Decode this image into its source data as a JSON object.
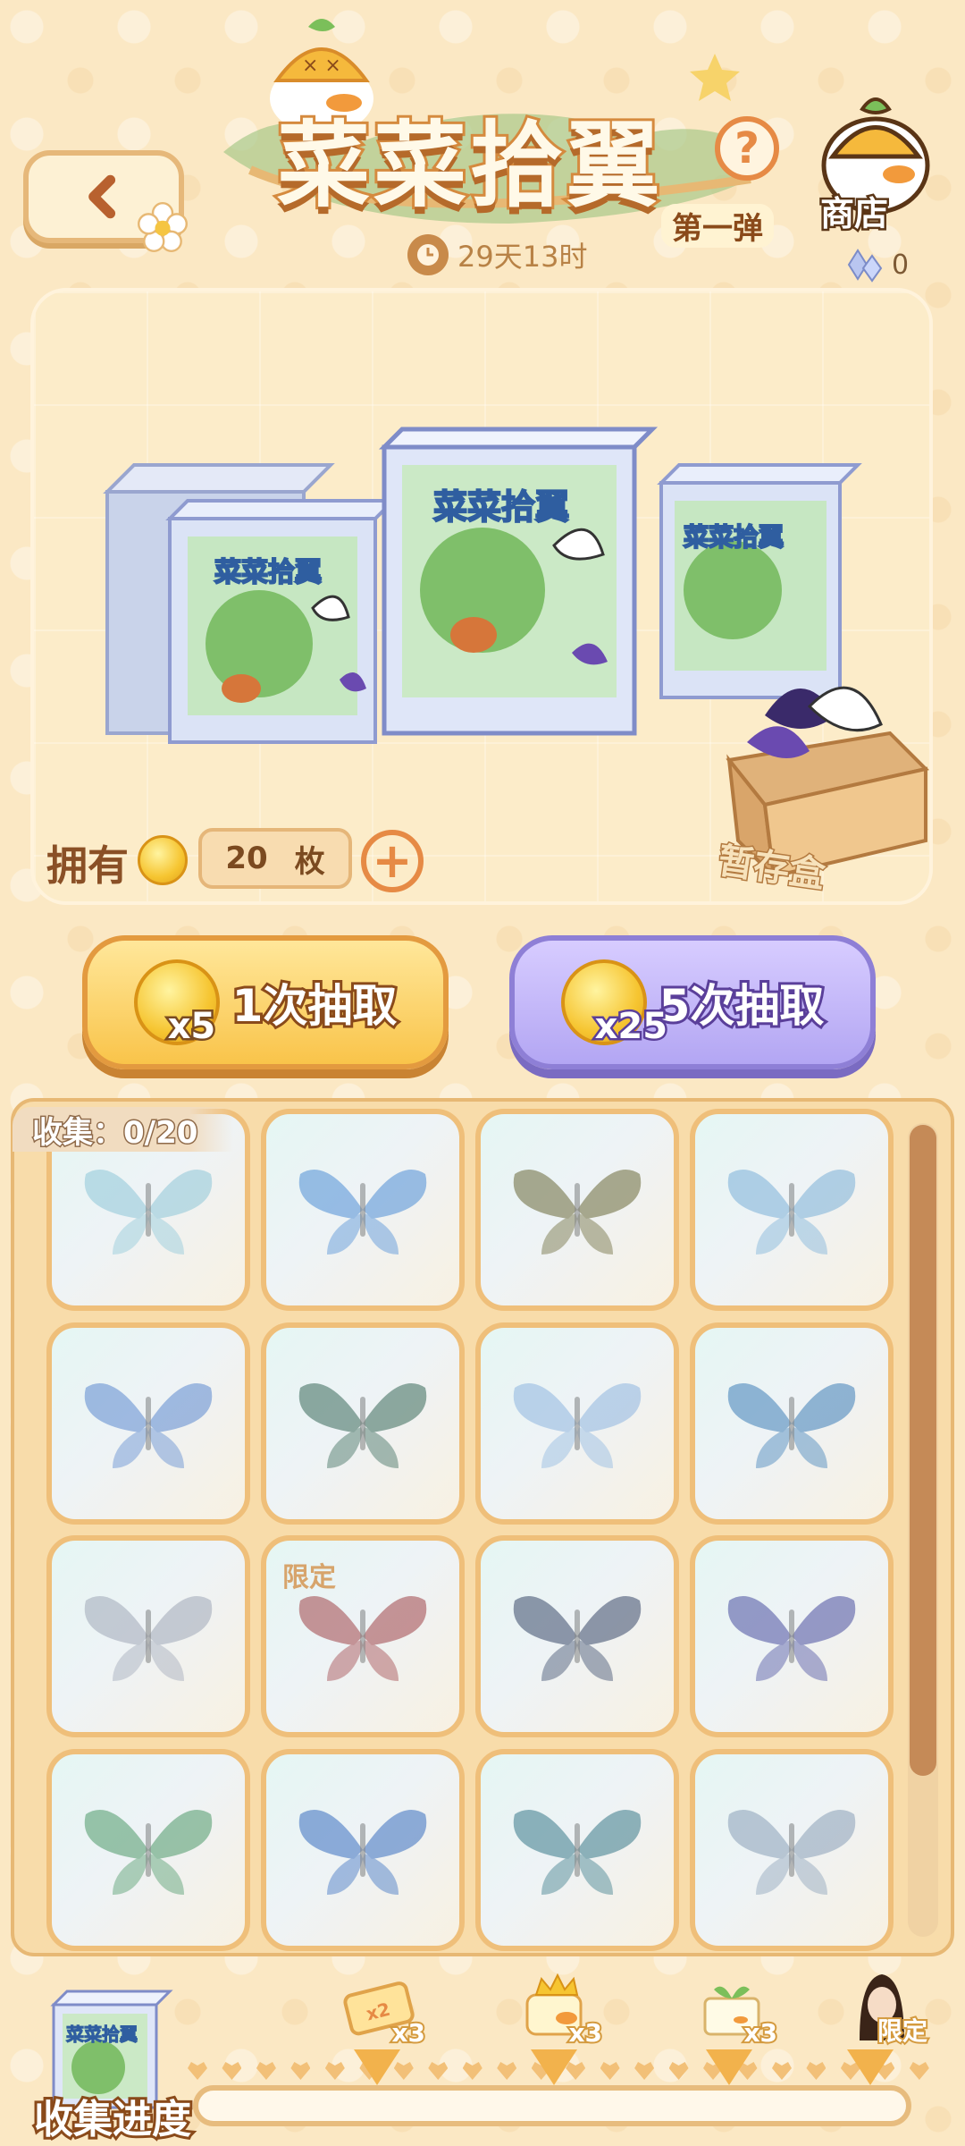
{
  "header": {
    "title": "菜菜拾翼",
    "subtitle": "第一弹",
    "timer": "29天13时",
    "shop_label": "商店",
    "gem_count": "0",
    "help_label": "?"
  },
  "display": {
    "own_label": "拥有",
    "own_value": "20",
    "own_unit": "枚",
    "storage_label": "暂存盒"
  },
  "draw": {
    "single": {
      "label": "1次抽取",
      "cost": "x5"
    },
    "five": {
      "label": "5次抽取",
      "cost": "x25"
    }
  },
  "collection": {
    "label": "收集：0/20",
    "limited_tag": "限定",
    "cards": [
      {
        "color": "#8fc7d8",
        "tag": ""
      },
      {
        "color": "#4f8fd6",
        "tag": ""
      },
      {
        "color": "#6b6a3a",
        "tag": ""
      },
      {
        "color": "#7bb0d8",
        "tag": ""
      },
      {
        "color": "#5d8ad0",
        "tag": ""
      },
      {
        "color": "#3a6a5a",
        "tag": ""
      },
      {
        "color": "#8fb6e0",
        "tag": ""
      },
      {
        "color": "#3f7fb8",
        "tag": ""
      },
      {
        "color": "#a0a8b8",
        "tag": ""
      },
      {
        "color": "#a0454a",
        "tag": "限定"
      },
      {
        "color": "#3a4a6a",
        "tag": ""
      },
      {
        "color": "#4a4fa0",
        "tag": ""
      },
      {
        "color": "#4f9a6a",
        "tag": ""
      },
      {
        "color": "#3a6fc0",
        "tag": ""
      },
      {
        "color": "#3a7a8a",
        "tag": ""
      },
      {
        "color": "#8aa0b8",
        "tag": ""
      }
    ]
  },
  "progress": {
    "label": "收集进度",
    "value": 0,
    "rewards": [
      {
        "name": "ticket",
        "mult": "x3"
      },
      {
        "name": "duck-crown",
        "mult": "x3"
      },
      {
        "name": "sprout-block",
        "mult": "x3"
      },
      {
        "name": "character",
        "mult": "限定"
      }
    ]
  },
  "colors": {
    "accent_orange": "#e68a45",
    "purple_button": "#b3a6f3",
    "yellow_button": "#f9c44a",
    "panel_bg": "#fcecc9"
  }
}
